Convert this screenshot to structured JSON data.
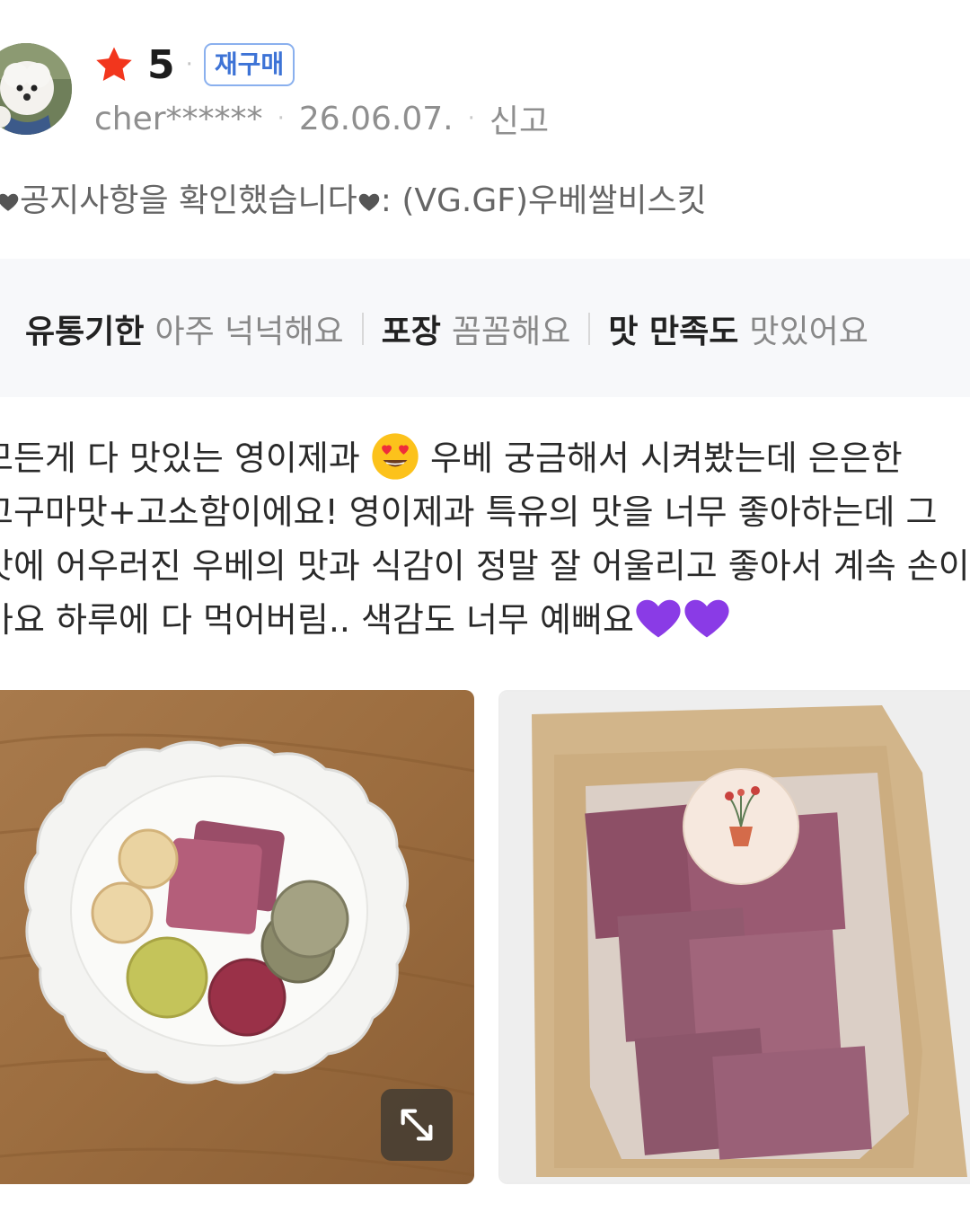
{
  "review": {
    "rating": "5",
    "badge": "재구매",
    "username": "cher******",
    "date": "26.06.07.",
    "report_label": "신고",
    "option_text": "공지사항을 확인했습니다",
    "option_suffix": ": (VG.GF)우베쌀비스킷",
    "summary": [
      {
        "label": "유통기한",
        "value": "아주 넉넉해요"
      },
      {
        "label": "포장",
        "value": "꼼꼼해요"
      },
      {
        "label": "맛 만족도",
        "value": "맛있어요"
      }
    ],
    "text_lines": {
      "l1a": "모든게 다 맛있는 영이제과",
      "l1b": " 우베 궁금해서 시켜봤는데 은은한",
      "l2": "고구마맛+고소함이에요! 영이제과 특유의 맛을 너무 좋아하는데 그",
      "l3": "맛에 어우러진 우베의 맛과 식감이 정말 잘 어울리고 좋아서 계속 손이",
      "l4": "가요 하루에 다 먹어버림.. 색감도 너무 예뻐요"
    },
    "icons": {
      "star": "star-icon",
      "heart": "heart-icon",
      "heart_eyes": "heart-eyes-emoji",
      "purple_heart": "purple-heart-emoji",
      "expand": "expand-icon"
    },
    "colors": {
      "star": "#f2361d",
      "badge": "#3d73d6",
      "purple_heart": "#8a3be6"
    }
  }
}
